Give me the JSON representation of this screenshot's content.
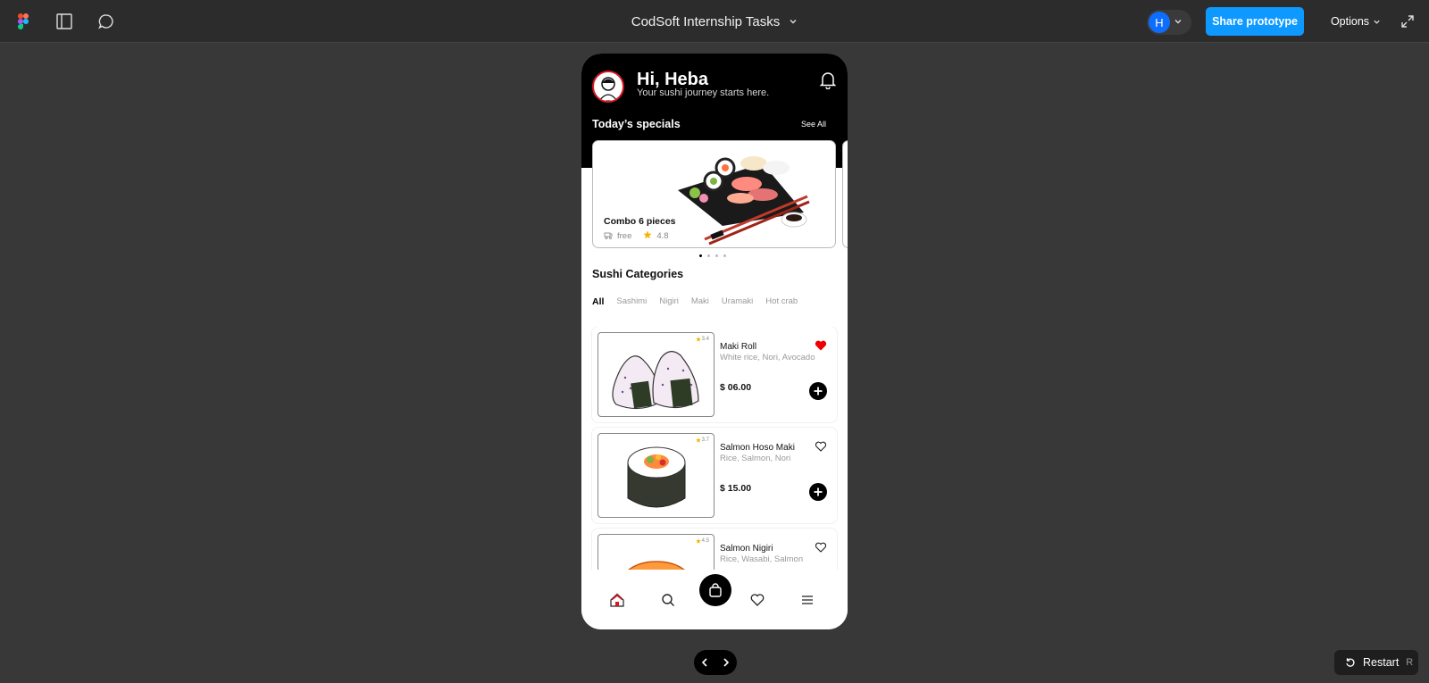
{
  "topbar": {
    "file_title": "CodSoft Internship Tasks",
    "user_initial": "H",
    "share_label": "Share prototype",
    "options_label": "Options"
  },
  "header": {
    "greeting": "Hi, Heba",
    "subtitle": "Your sushi journey starts here."
  },
  "specials": {
    "title": "Today’s specials",
    "see_all": "See All",
    "card": {
      "name": "Combo 6 pieces",
      "delivery": "free",
      "rating": "4.8"
    },
    "pages": 4,
    "active_page": 1
  },
  "categories": {
    "title": "Sushi Categories",
    "tabs": [
      "All",
      "Sashimi",
      "Nigiri",
      "Maki",
      "Uramaki",
      "Hot crab"
    ],
    "active": "All"
  },
  "items": [
    {
      "rating": "3.4",
      "name": "Maki Roll",
      "desc": "White rice, Nori, Avocado",
      "price": "$ 06.00",
      "favorite": true
    },
    {
      "rating": "3.7",
      "name": "Salmon Hoso Maki",
      "desc": "Rice, Salmon, Nori",
      "price": "$ 15.00",
      "favorite": false
    },
    {
      "rating": "4.5",
      "name": "Salmon Nigiri",
      "desc": "Rice, Wasabi, Salmon",
      "price": "",
      "favorite": false
    }
  ],
  "bottom_nav": [
    "home-icon",
    "search-icon",
    "bag-icon",
    "heart-icon",
    "menu-icon"
  ],
  "controls": {
    "restart_label": "Restart",
    "restart_key": "R"
  },
  "colors": {
    "accent": "#0d99ff",
    "brand_red": "#d71920",
    "star": "#f5b301"
  }
}
